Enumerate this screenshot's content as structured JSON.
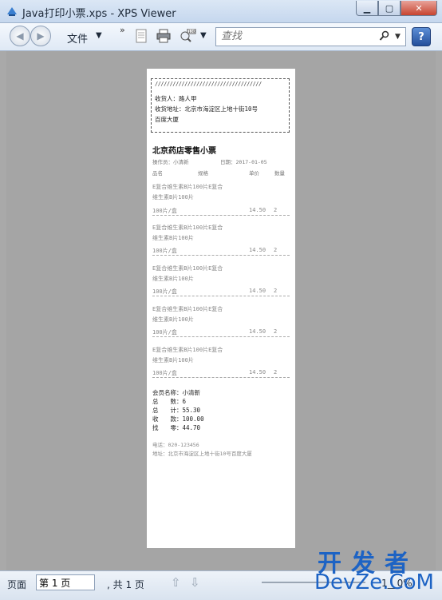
{
  "window": {
    "title": "Java打印小票.xps - XPS Viewer"
  },
  "toolbar": {
    "file_menu": "文件",
    "search_placeholder": "查找",
    "help": "?",
    "chevron": "»"
  },
  "receipt": {
    "slashes": "////////////////////////////////////",
    "recipient": "收货人：路人甲",
    "address_line1": "收货地址：北京市海淀区上地十街10号",
    "address_line2": "百度大厦",
    "shop_title": "北京药店零售小票",
    "operator": "操作员：小清新",
    "date": "日期：2017-01-05",
    "headers": {
      "name": "品名",
      "spec": "规格",
      "price": "单价",
      "qty": "数量"
    },
    "items": [
      {
        "name1": "E复合维生素B片100片E复合",
        "name2": "维生素B片100片",
        "spec": "100片/盒",
        "price": "14.50",
        "qty": "2"
      },
      {
        "name1": "E复合维生素B片100片E复合",
        "name2": "维生素B片100片",
        "spec": "100片/盒",
        "price": "14.50",
        "qty": "2"
      },
      {
        "name1": "E复合维生素B片100片E复合",
        "name2": "维生素B片100片",
        "spec": "100片/盒",
        "price": "14.50",
        "qty": "2"
      },
      {
        "name1": "E复合维生素B片100片E复合",
        "name2": "维生素B片100片",
        "spec": "100片/盒",
        "price": "14.50",
        "qty": "2"
      },
      {
        "name1": "E复合维生素B片100片E复合",
        "name2": "维生素B片100片",
        "spec": "100片/盒",
        "price": "14.50",
        "qty": "2"
      }
    ],
    "member": "会员名称：小清新",
    "count": "总　　数：6",
    "total": "总　　计：55.30",
    "received": "收　　款：100.00",
    "change": "找　　零：44.70",
    "phone": "电话：020-123456",
    "footer_address": "地址：北京市海淀区上地十街10号百度大厦"
  },
  "statusbar": {
    "page_label": "页面",
    "page_value": "第 1 页",
    "page_total": ", 共 1 页",
    "zoom": "1__0%"
  },
  "watermark": {
    "top": "开发者",
    "bottom": "DevZe.CoM"
  }
}
